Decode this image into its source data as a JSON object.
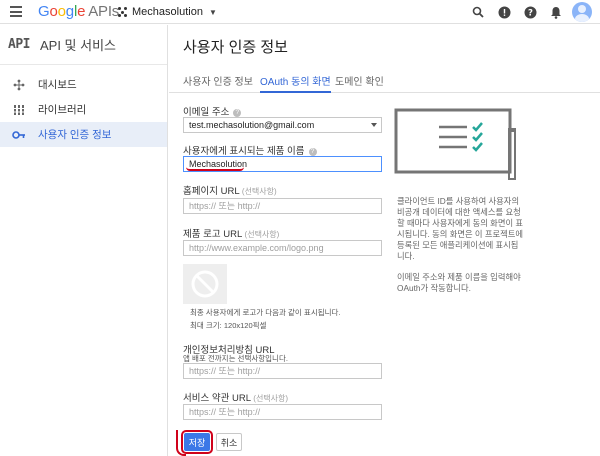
{
  "header": {
    "brand_google": "Google",
    "brand_apis": "APIs",
    "project_name": "Mechasolution",
    "icons": [
      "search-icon",
      "feedback-icon",
      "help-icon",
      "notifications-icon",
      "account-avatar"
    ]
  },
  "sidebar": {
    "title": "API 및 서비스",
    "logo": "API",
    "items": [
      {
        "label": "대시보드",
        "icon": "dashboard-icon",
        "active": false
      },
      {
        "label": "라이브러리",
        "icon": "library-icon",
        "active": false
      },
      {
        "label": "사용자 인증 정보",
        "icon": "key-icon",
        "active": true
      }
    ]
  },
  "main": {
    "title": "사용자 인증 정보",
    "tabs": [
      {
        "label": "사용자 인증 정보",
        "active": false
      },
      {
        "label": "OAuth 동의 화면",
        "active": true
      },
      {
        "label": "도메인 확인",
        "active": false
      }
    ],
    "form": {
      "email_label": "이메일 주소",
      "email_value": "test.mechasolution@gmail.com",
      "product_label": "사용자에게 표시되는 제품 이름",
      "product_value": "Mechasolution",
      "homepage_label": "홈페이지 URL",
      "homepage_hint": "(선택사항)",
      "homepage_placeholder": "https:// 또는 http://",
      "logo_label": "제품 로고 URL",
      "logo_hint": "(선택사항)",
      "logo_placeholder": "http://www.example.com/logo.png",
      "logo_note1": "최종 사용자에게 로고가 다음과 같이 표시됩니다.",
      "logo_note2": "최대 크기: 120x120픽셀",
      "privacy_label": "개인정보처리방침 URL",
      "privacy_note": "앱 배포 전까지는 선택사항입니다.",
      "privacy_placeholder": "https:// 또는 http://",
      "terms_label": "서비스 약관 URL",
      "terms_hint": "(선택사항)",
      "terms_placeholder": "https:// 또는 http://",
      "save_label": "저장",
      "cancel_label": "취소"
    },
    "info": {
      "paragraph1": "클라이언트 ID를 사용하여 사용자의 비공개 데이터에 대한 액세스를 요청할 때마다 사용자에게 동의 화면이 표시됩니다. 동의 화면은 이 프로젝트에 등록된 모든 애플리케이션에 표시됩니다.",
      "paragraph2": "이메일 주소와 제품 이름을 입력해야 OAuth가 작동합니다."
    }
  },
  "colors": {
    "accent": "#3367d6",
    "primary_button": "#3b78e7",
    "annotation_red": "#d0021b",
    "check_teal": "#26a69a"
  }
}
